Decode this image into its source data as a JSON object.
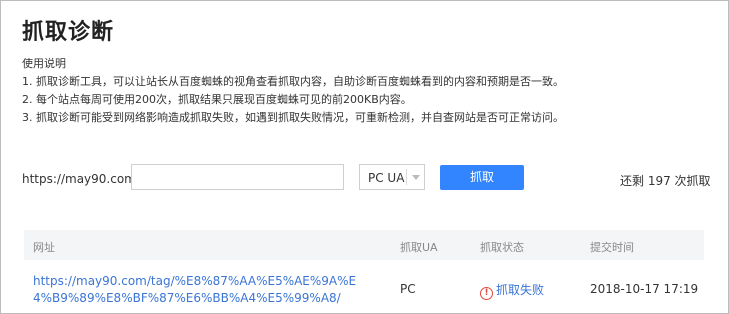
{
  "page": {
    "title": "抓取诊断"
  },
  "instructions": {
    "heading": "使用说明",
    "lines": [
      "1. 抓取诊断工具，可以让站长从百度蜘蛛的视角查看抓取内容，自助诊断百度蜘蛛看到的内容和预期是否一致。",
      "2. 每个站点每周可使用200次，抓取结果只展现百度蜘蛛可见的前200KB内容。",
      "3. 抓取诊断可能受到网络影响造成抓取失败，如遇到抓取失败情况，可重新检测，并自查网站是否可正常访问。"
    ]
  },
  "form": {
    "url_prefix": "https://may90.com/",
    "url_value": "",
    "ua_selected": "PC UA",
    "submit_label": "抓取",
    "remaining_text": "还剩 197 次抓取"
  },
  "table": {
    "headers": [
      "网址",
      "抓取UA",
      "抓取状态",
      "提交时间"
    ],
    "rows": [
      {
        "url": "https://may90.com/tag/%E8%87%AA%E5%AE%9A%E4%B9%89%E8%BF%87%E6%BB%A4%E5%99%A8/",
        "ua": "PC",
        "status": "抓取失败",
        "time": "2018-10-17 17:19"
      }
    ]
  },
  "colors": {
    "accent": "#3285ff",
    "link": "#3a75d6",
    "error": "#e0483e"
  },
  "icons": {
    "status_warning": "exclamation-circle-icon",
    "select_arrow": "triangle-down-icon"
  }
}
